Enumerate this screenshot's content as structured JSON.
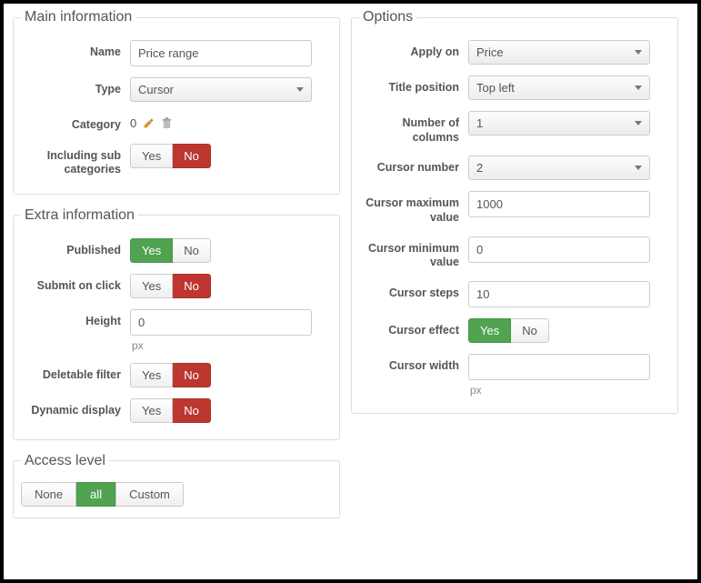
{
  "main": {
    "legend": "Main information",
    "name_label": "Name",
    "name_value": "Price range",
    "type_label": "Type",
    "type_value": "Cursor",
    "category_label": "Category",
    "category_value": "0",
    "subcat_label": "Including sub categories",
    "yes": "Yes",
    "no": "No"
  },
  "extra": {
    "legend": "Extra information",
    "published_label": "Published",
    "submit_label": "Submit on click",
    "height_label": "Height",
    "height_value": "0",
    "height_unit": "px",
    "deletable_label": "Deletable filter",
    "dynamic_label": "Dynamic display",
    "yes": "Yes",
    "no": "No"
  },
  "access": {
    "legend": "Access level",
    "none": "None",
    "all": "all",
    "custom": "Custom"
  },
  "options": {
    "legend": "Options",
    "apply_on_label": "Apply on",
    "apply_on_value": "Price",
    "title_pos_label": "Title position",
    "title_pos_value": "Top left",
    "num_cols_label": "Number of columns",
    "num_cols_value": "1",
    "cursor_num_label": "Cursor number",
    "cursor_num_value": "2",
    "cursor_max_label": "Cursor maximum value",
    "cursor_max_value": "1000",
    "cursor_min_label": "Cursor minimum value",
    "cursor_min_value": "0",
    "cursor_steps_label": "Cursor steps",
    "cursor_steps_value": "10",
    "cursor_effect_label": "Cursor effect",
    "cursor_width_label": "Cursor width",
    "cursor_width_value": "",
    "cursor_width_unit": "px",
    "yes": "Yes",
    "no": "No"
  }
}
